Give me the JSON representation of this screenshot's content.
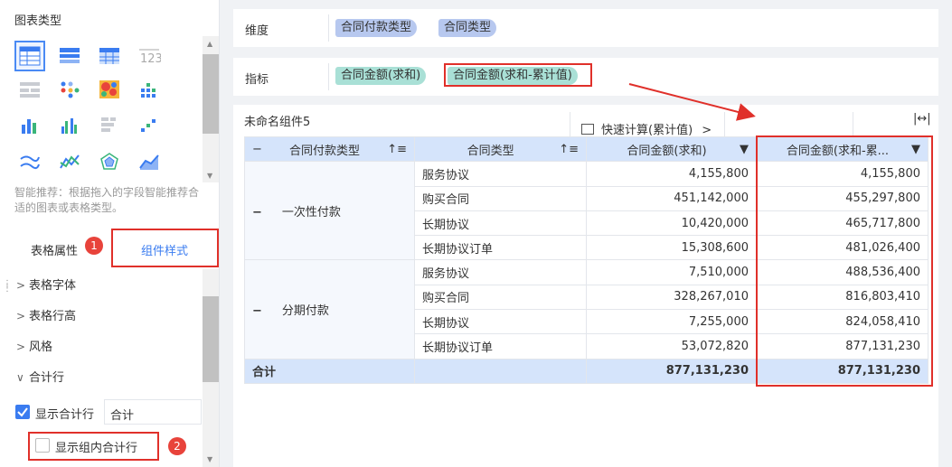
{
  "left_panel": {
    "chart_type_title": "图表类型",
    "chart_icons": [
      "table-icon",
      "cross-table-icon",
      "detail-table-icon",
      "number-icon",
      "grid-icon",
      "dot-grid-icon",
      "heatmap-icon",
      "dot-bar-icon",
      "bar-chart-icon",
      "grouped-bar-icon",
      "horizontal-bar-icon",
      "step-icon",
      "line-chart-icon",
      "multi-line-icon",
      "radar-icon",
      "area-chart-icon"
    ],
    "hint": "智能推荐：根据拖入的字段智能推荐合适的图表或表格类型。",
    "tabs": {
      "table_props": "表格属性",
      "component_style": "组件样式"
    },
    "badge_1": "1",
    "badge_2": "2",
    "menu": [
      "表格字体",
      "表格行高",
      "风格",
      "合计行"
    ],
    "show_total_label": "显示合计行",
    "total_input_value": "合计",
    "show_group_total_label": "显示组内合计行",
    "accent": "#3a7cf0",
    "highlight": "#e0302a"
  },
  "dimension": {
    "label": "维度",
    "chips": [
      "合同付款类型",
      "合同类型"
    ]
  },
  "indicator": {
    "label": "指标",
    "chips": [
      "合同金额(求和)",
      "合同金额(求和-累计值)"
    ]
  },
  "widget": {
    "title": "未命名组件5",
    "quick_calc": "快速计算(累计值)",
    "quick_calc_arrow": ">",
    "expand": "|↔|",
    "headers": [
      "合同付款类型",
      "合同类型",
      "合同金额(求和)",
      "合同金额(求和-累..."
    ],
    "groups": [
      {
        "name": "一次性付款",
        "rows": [
          {
            "type": "服务协议",
            "amount": "4,155,800",
            "cumulative": "4,155,800"
          },
          {
            "type": "购买合同",
            "amount": "451,142,000",
            "cumulative": "455,297,800"
          },
          {
            "type": "长期协议",
            "amount": "10,420,000",
            "cumulative": "465,717,800"
          },
          {
            "type": "长期协议订单",
            "amount": "15,308,600",
            "cumulative": "481,026,400"
          }
        ]
      },
      {
        "name": "分期付款",
        "rows": [
          {
            "type": "服务协议",
            "amount": "7,510,000",
            "cumulative": "488,536,400"
          },
          {
            "type": "购买合同",
            "amount": "328,267,010",
            "cumulative": "816,803,410"
          },
          {
            "type": "长期协议",
            "amount": "7,255,000",
            "cumulative": "824,058,410"
          },
          {
            "type": "长期协议订单",
            "amount": "53,072,820",
            "cumulative": "877,131,230"
          }
        ]
      }
    ],
    "total": {
      "label": "合计",
      "amount": "877,131,230",
      "cumulative": "877,131,230"
    }
  }
}
